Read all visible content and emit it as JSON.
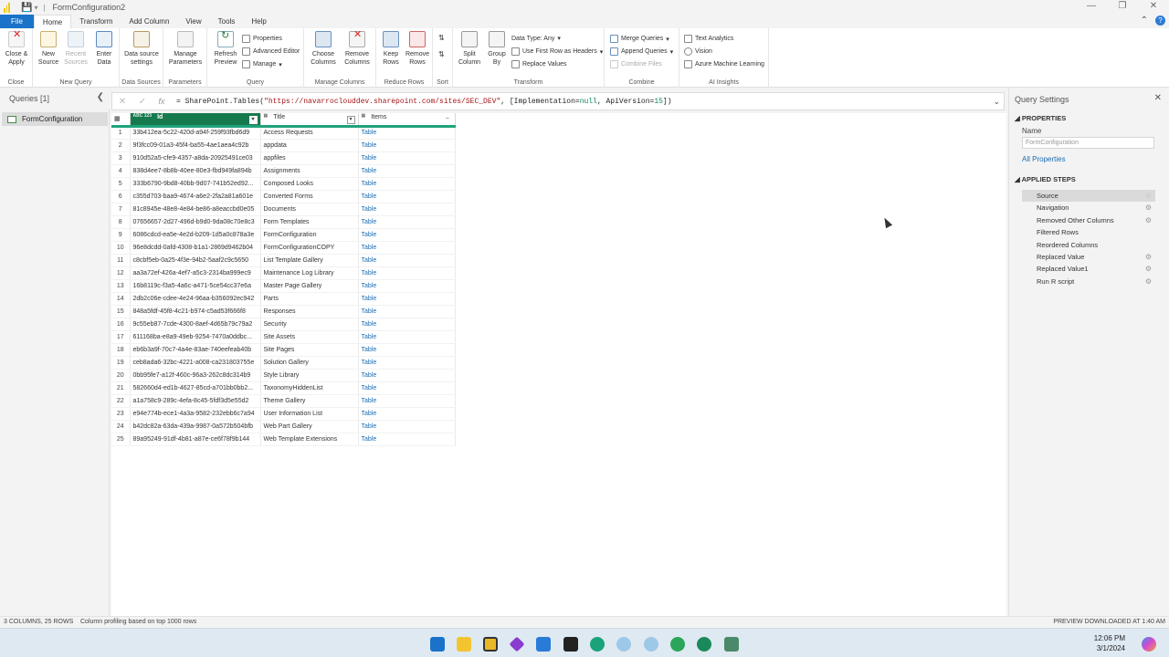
{
  "window": {
    "title": "FormConfiguration2"
  },
  "menu_tabs": [
    "File",
    "Home",
    "Transform",
    "Add Column",
    "View",
    "Tools",
    "Help"
  ],
  "ribbon": {
    "close_group": {
      "label": "Close",
      "btn": "Close & Apply"
    },
    "new_query_group": {
      "label": "New Query",
      "new_source": "New Source",
      "recent_sources": "Recent Sources",
      "enter_data": "Enter Data"
    },
    "data_sources_group": {
      "label": "Data Sources",
      "btn": "Data source settings"
    },
    "parameters_group": {
      "label": "Parameters",
      "btn": "Manage Parameters"
    },
    "query_group": {
      "label": "Query",
      "refresh": "Refresh Preview",
      "properties": "Properties",
      "advanced_editor": "Advanced Editor",
      "manage": "Manage"
    },
    "manage_columns_group": {
      "label": "Manage Columns",
      "choose": "Choose Columns",
      "remove": "Remove Columns"
    },
    "reduce_rows_group": {
      "label": "Reduce Rows",
      "keep": "Keep Rows",
      "remove": "Remove Rows"
    },
    "sort_group": {
      "label": "Sort"
    },
    "transform_group": {
      "label": "Transform",
      "split": "Split Column",
      "group_by": "Group By",
      "data_type": "Data Type: Any",
      "first_row": "Use First Row as Headers",
      "replace": "Replace Values"
    },
    "combine_group": {
      "label": "Combine",
      "merge": "Merge Queries",
      "append": "Append Queries",
      "combine_files": "Combine Files"
    },
    "ai_group": {
      "label": "AI Insights",
      "text": "Text Analytics",
      "vision": "Vision",
      "azure_ml": "Azure Machine Learning"
    }
  },
  "queries_pane": {
    "header": "Queries [1]",
    "items": [
      "FormConfiguration"
    ]
  },
  "formula": {
    "prefix": "= SharePoint.Tables(",
    "url": "\"https://navarroclouddev.sharepoint.com/sites/SEC_DEV\"",
    "mid": ", [Implementation=",
    "impl": "null",
    "mid2": ", ApiVersion=",
    "api": "15",
    "suffix": "])"
  },
  "grid": {
    "columns": [
      {
        "name": "Id",
        "type": "ABC 123"
      },
      {
        "name": "Title",
        "type": ""
      },
      {
        "name": "Items",
        "type": ""
      }
    ],
    "rows": [
      [
        "1",
        "33b412ea-5c22-420d-a94f-259f93fbd6d9",
        "Access Requests",
        "Table"
      ],
      [
        "2",
        "9f3fcc09-01a3-45f4-ba55-4ae1aea4c92b",
        "appdata",
        "Table"
      ],
      [
        "3",
        "910d52a5-cfe9-4357-a8da-20925491ce03",
        "appfiles",
        "Table"
      ],
      [
        "4",
        "838d4ee7-8b8b-40ee-80e3-fbd949fa894b",
        "Assignments",
        "Table"
      ],
      [
        "5",
        "333b6790-9bd8-40bb-9d07-741b52ed92...",
        "Composed Looks",
        "Table"
      ],
      [
        "6",
        "c355d703-baa9-4674-a6e2-2fa2a81a601e",
        "Converted Forms",
        "Table"
      ],
      [
        "7",
        "81c8945e-48e8-4e84-be86-a8eaccbd0e05",
        "Documents",
        "Table"
      ],
      [
        "8",
        "07656657-2d27-496d-b9d0-9da08c70e8c3",
        "Form Templates",
        "Table"
      ],
      [
        "9",
        "6086cdcd-ea5e-4e2d-b209-1d5a0c878a3e",
        "FormConfiguration",
        "Table"
      ],
      [
        "10",
        "96e8dcdd-0afd-4308-b1a1-2869d9462b04",
        "FormConfigurationCOPY",
        "Table"
      ],
      [
        "11",
        "c8cbf5eb-0a25-4f3e-94b2-5aaf2c9c5650",
        "List Template Gallery",
        "Table"
      ],
      [
        "12",
        "aa3a72ef-426a-4ef7-a5c3-2314ba999ec9",
        "Maintenance Log Library",
        "Table"
      ],
      [
        "13",
        "16b8119c-f3a5-4a6c-a471-5ce54cc37e6a",
        "Master Page Gallery",
        "Table"
      ],
      [
        "14",
        "2db2c06e-cdee-4e24-96aa-b356092ec942",
        "Parts",
        "Table"
      ],
      [
        "15",
        "848a5fdf-45f8-4c21-b974-c5ad53f666f8",
        "Responses",
        "Table"
      ],
      [
        "16",
        "9c55eb87-7cde-4300-8aef-4d65b79c79a2",
        "Security",
        "Table"
      ],
      [
        "17",
        "611168ba-e8a9-49eb-9254-7470a0ddbc...",
        "Site Assets",
        "Table"
      ],
      [
        "18",
        "eb6b3a9f-70c7-4a4e-83ae-740eefeab40b",
        "Site Pages",
        "Table"
      ],
      [
        "19",
        "ceb8ada6-32bc-4221-a008-ca231803755e",
        "Solution Gallery",
        "Table"
      ],
      [
        "20",
        "0bb95fe7-a12f-460c-96a3-262c8dc314b9",
        "Style Library",
        "Table"
      ],
      [
        "21",
        "582660d4-ed1b-4627-85cd-a701bb0bb2...",
        "TaxonomyHiddenList",
        "Table"
      ],
      [
        "22",
        "a1a758c9-289c-4efa-8c45-5fdf3d5e55d2",
        "Theme Gallery",
        "Table"
      ],
      [
        "23",
        "e94e774b-ece1-4a3a-9582-232ebb6c7a94",
        "User Information List",
        "Table"
      ],
      [
        "24",
        "b42dc82a-63da-439a-9987-0a572b504bfb",
        "Web Part Gallery",
        "Table"
      ],
      [
        "25",
        "89a95249-91df-4b81-a87e-ce6f78f9b144",
        "Web Template Extensions",
        "Table"
      ]
    ]
  },
  "query_settings": {
    "title": "Query Settings",
    "properties_header": "PROPERTIES",
    "name_label": "Name",
    "name_value": "FormConfiguration",
    "all_properties": "All Properties",
    "steps_header": "APPLIED STEPS",
    "steps": [
      "Source",
      "Navigation",
      "Removed Other Columns",
      "Filtered Rows",
      "Reordered Columns",
      "Replaced Value",
      "Replaced Value1",
      "Run R script"
    ]
  },
  "status": {
    "left": "3 COLUMNS, 25 ROWS",
    "profiling": "Column profiling based on top 1000 rows",
    "right": "PREVIEW DOWNLOADED AT 1:40 AM"
  },
  "taskbar": {
    "time": "12:06 PM",
    "date": "3/1/2024"
  },
  "colors": {
    "accent": "#1a73c9",
    "id_header": "#167a4e",
    "table_link": "#1a6db3"
  }
}
